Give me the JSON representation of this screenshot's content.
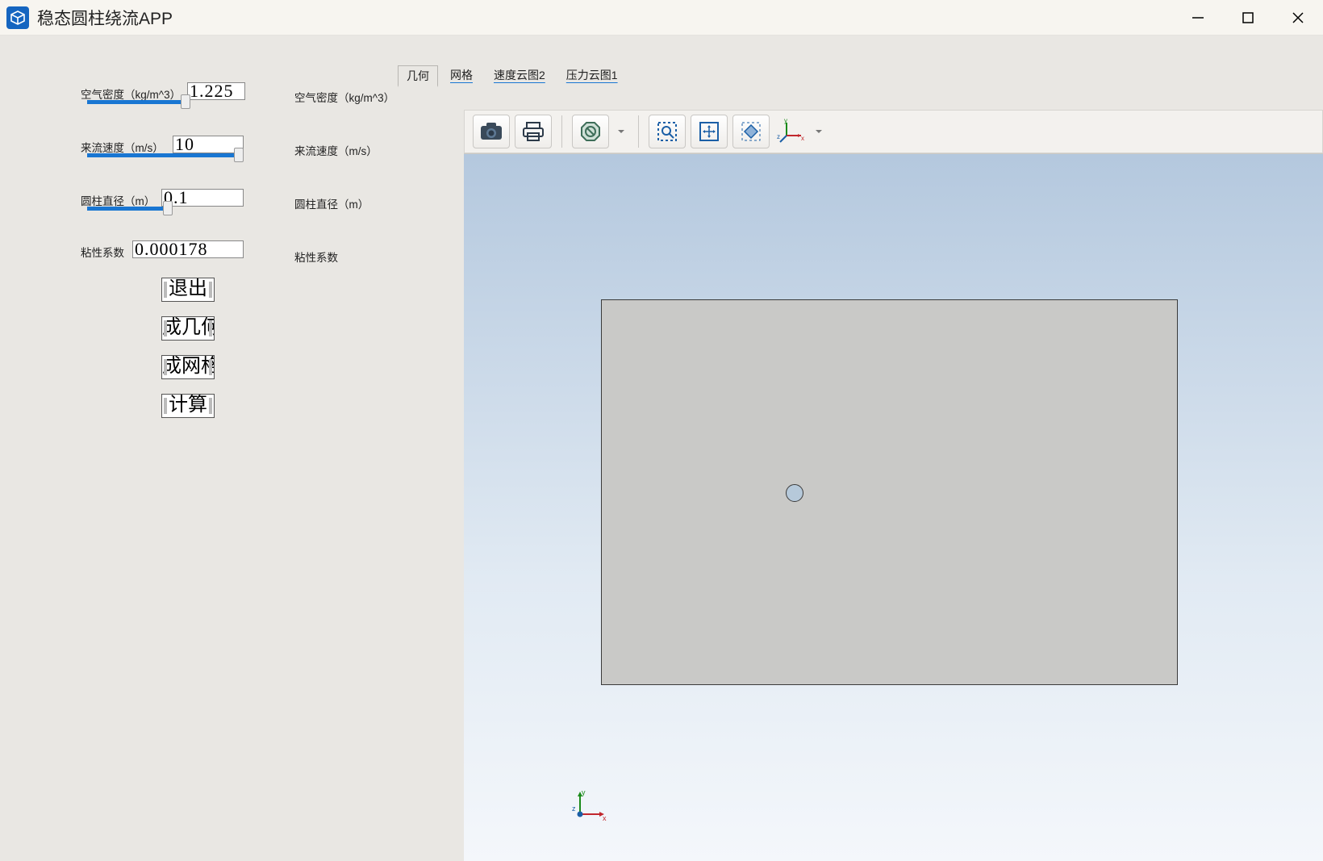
{
  "window": {
    "title": "稳态圆柱绕流APP"
  },
  "params": {
    "density": {
      "label": "空气密度（kg/m^3）",
      "value": "1.225"
    },
    "velocity": {
      "label": "来流速度（m/s）",
      "value": "10"
    },
    "diameter": {
      "label": "圆柱直径（m）",
      "value": "0.1"
    },
    "viscosity": {
      "label": "粘性系数",
      "value": "0.000178"
    }
  },
  "labels_col2": {
    "density": "空气密度（kg/m^3）",
    "velocity": "来流速度（m/s）",
    "diameter": "圆柱直径（m）",
    "viscosity": "粘性系数"
  },
  "buttons": {
    "exit": "退出",
    "gen_geom": "成几何",
    "gen_mesh": "成网格",
    "compute": "计算"
  },
  "tabs": {
    "geom": "几何",
    "mesh": "网格",
    "velocity_contour": "速度云图2",
    "pressure_contour": "压力云图1"
  }
}
